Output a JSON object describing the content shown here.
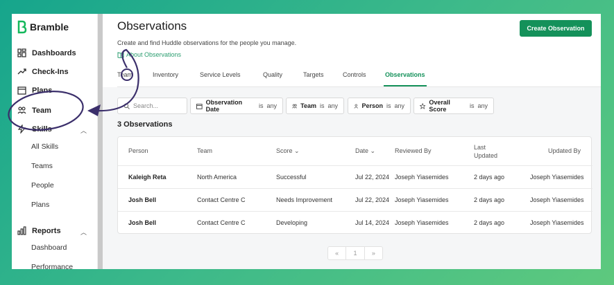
{
  "app": {
    "name": "Bramble"
  },
  "sidebar": {
    "items": [
      {
        "label": "Dashboards",
        "icon": "dashboard-icon"
      },
      {
        "label": "Check-Ins",
        "icon": "trend-icon"
      },
      {
        "label": "Plans",
        "icon": "calendar-icon"
      },
      {
        "label": "Team",
        "icon": "people-icon"
      },
      {
        "label": "Skills",
        "icon": "bolt-icon"
      },
      {
        "label": "Reports",
        "icon": "bar-chart-icon"
      }
    ],
    "skills_sub": [
      "All Skills",
      "Teams",
      "People",
      "Plans"
    ],
    "reports_sub": [
      "Dashboard",
      "Performance"
    ]
  },
  "header": {
    "title": "Observations",
    "subtitle": "Create and find Huddle observations for the people you manage.",
    "about_link": "About Observations",
    "create_button": "Create Observation"
  },
  "tabs": [
    "Team",
    "Inventory",
    "Service Levels",
    "Quality",
    "Targets",
    "Controls",
    "Observations"
  ],
  "active_tab": "Observations",
  "filters": {
    "search_placeholder": "Search...",
    "observation_date": {
      "label": "Observation Date",
      "is": "is",
      "value": "any"
    },
    "team": {
      "label": "Team",
      "is": "is",
      "value": "any"
    },
    "person": {
      "label": "Person",
      "is": "is",
      "value": "any"
    },
    "overall_score": {
      "label": "Overall Score",
      "is": "is",
      "value": "any"
    }
  },
  "count_label": "3 Observations",
  "table": {
    "headers": [
      "Person",
      "Team",
      "Score",
      "Date",
      "Reviewed By",
      "Last Updated",
      "Updated By"
    ],
    "last_updated_line1": "Last",
    "last_updated_line2": "Updated",
    "rows": [
      [
        "Kaleigh Reta",
        "North America",
        "Successful",
        "Jul 22, 2024",
        "Joseph Yiasemides",
        "2 days ago",
        "Joseph Yiasemides"
      ],
      [
        "Josh Bell",
        "Contact Centre C",
        "Needs Improvement",
        "Jul 22, 2024",
        "Joseph Yiasemides",
        "2 days ago",
        "Joseph Yiasemides"
      ],
      [
        "Josh Bell",
        "Contact Centre C",
        "Developing",
        "Jul 14, 2024",
        "Joseph Yiasemides",
        "2 days ago",
        "Joseph Yiasemides"
      ]
    ]
  },
  "pagination": {
    "prev": "«",
    "page": "1",
    "next": "»"
  },
  "colors": {
    "brand": "#14915a",
    "annotation": "#3b2f6b"
  }
}
